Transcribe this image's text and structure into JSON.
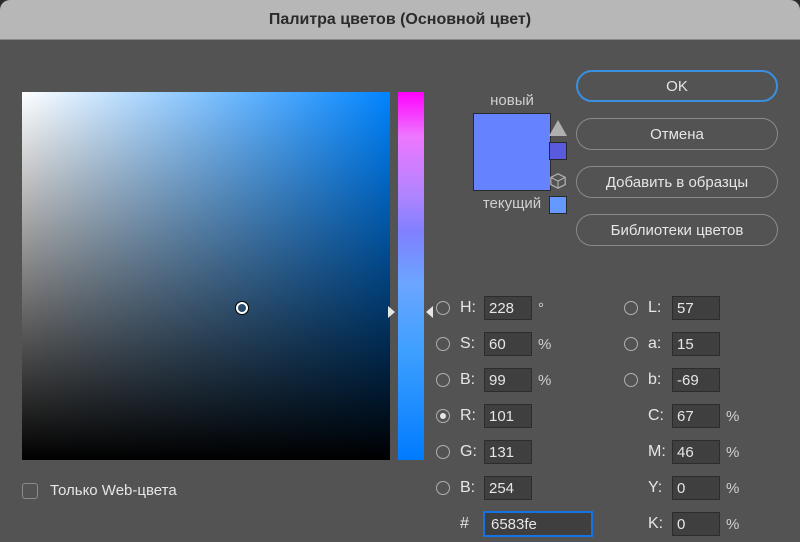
{
  "title": "Палитра цветов (Основной цвет)",
  "preview": {
    "new_label": "новый",
    "current_label": "текущий"
  },
  "buttons": {
    "ok": "OK",
    "cancel": "Отмена",
    "add_swatch": "Добавить в образцы",
    "libraries": "Библиотеки цветов"
  },
  "web_only": "Только Web-цвета",
  "hsb": {
    "h_label": "H:",
    "h": "228",
    "h_unit": "°",
    "s_label": "S:",
    "s": "60",
    "s_unit": "%",
    "b_label": "B:",
    "b": "99",
    "b_unit": "%"
  },
  "rgb": {
    "r_label": "R:",
    "r": "101",
    "g_label": "G:",
    "g": "131",
    "b_label": "B:",
    "b": "254"
  },
  "lab": {
    "l_label": "L:",
    "l": "57",
    "a_label": "a:",
    "a": "15",
    "b_label": "b:",
    "b": "-69"
  },
  "cmyk": {
    "c_label": "C:",
    "c": "67",
    "unit": "%",
    "m_label": "M:",
    "m": "46",
    "y_label": "Y:",
    "y": "0",
    "k_label": "K:",
    "k": "0"
  },
  "hex_label": "#",
  "hex": "6583fe",
  "colors": {
    "new": "#6583fe",
    "current": "#6583fe",
    "warn_swatch": "#5a5adf",
    "cube_swatch": "#6699ff"
  }
}
